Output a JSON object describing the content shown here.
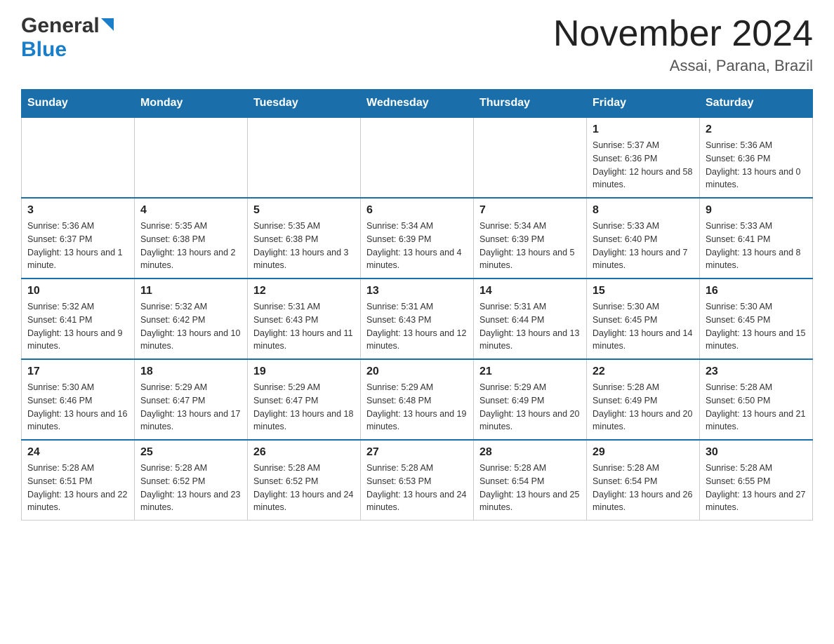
{
  "logo": {
    "general": "General",
    "blue": "Blue"
  },
  "header": {
    "title": "November 2024",
    "location": "Assai, Parana, Brazil"
  },
  "weekdays": [
    "Sunday",
    "Monday",
    "Tuesday",
    "Wednesday",
    "Thursday",
    "Friday",
    "Saturday"
  ],
  "weeks": [
    [
      {
        "day": "",
        "info": ""
      },
      {
        "day": "",
        "info": ""
      },
      {
        "day": "",
        "info": ""
      },
      {
        "day": "",
        "info": ""
      },
      {
        "day": "",
        "info": ""
      },
      {
        "day": "1",
        "info": "Sunrise: 5:37 AM\nSunset: 6:36 PM\nDaylight: 12 hours and 58 minutes."
      },
      {
        "day": "2",
        "info": "Sunrise: 5:36 AM\nSunset: 6:36 PM\nDaylight: 13 hours and 0 minutes."
      }
    ],
    [
      {
        "day": "3",
        "info": "Sunrise: 5:36 AM\nSunset: 6:37 PM\nDaylight: 13 hours and 1 minute."
      },
      {
        "day": "4",
        "info": "Sunrise: 5:35 AM\nSunset: 6:38 PM\nDaylight: 13 hours and 2 minutes."
      },
      {
        "day": "5",
        "info": "Sunrise: 5:35 AM\nSunset: 6:38 PM\nDaylight: 13 hours and 3 minutes."
      },
      {
        "day": "6",
        "info": "Sunrise: 5:34 AM\nSunset: 6:39 PM\nDaylight: 13 hours and 4 minutes."
      },
      {
        "day": "7",
        "info": "Sunrise: 5:34 AM\nSunset: 6:39 PM\nDaylight: 13 hours and 5 minutes."
      },
      {
        "day": "8",
        "info": "Sunrise: 5:33 AM\nSunset: 6:40 PM\nDaylight: 13 hours and 7 minutes."
      },
      {
        "day": "9",
        "info": "Sunrise: 5:33 AM\nSunset: 6:41 PM\nDaylight: 13 hours and 8 minutes."
      }
    ],
    [
      {
        "day": "10",
        "info": "Sunrise: 5:32 AM\nSunset: 6:41 PM\nDaylight: 13 hours and 9 minutes."
      },
      {
        "day": "11",
        "info": "Sunrise: 5:32 AM\nSunset: 6:42 PM\nDaylight: 13 hours and 10 minutes."
      },
      {
        "day": "12",
        "info": "Sunrise: 5:31 AM\nSunset: 6:43 PM\nDaylight: 13 hours and 11 minutes."
      },
      {
        "day": "13",
        "info": "Sunrise: 5:31 AM\nSunset: 6:43 PM\nDaylight: 13 hours and 12 minutes."
      },
      {
        "day": "14",
        "info": "Sunrise: 5:31 AM\nSunset: 6:44 PM\nDaylight: 13 hours and 13 minutes."
      },
      {
        "day": "15",
        "info": "Sunrise: 5:30 AM\nSunset: 6:45 PM\nDaylight: 13 hours and 14 minutes."
      },
      {
        "day": "16",
        "info": "Sunrise: 5:30 AM\nSunset: 6:45 PM\nDaylight: 13 hours and 15 minutes."
      }
    ],
    [
      {
        "day": "17",
        "info": "Sunrise: 5:30 AM\nSunset: 6:46 PM\nDaylight: 13 hours and 16 minutes."
      },
      {
        "day": "18",
        "info": "Sunrise: 5:29 AM\nSunset: 6:47 PM\nDaylight: 13 hours and 17 minutes."
      },
      {
        "day": "19",
        "info": "Sunrise: 5:29 AM\nSunset: 6:47 PM\nDaylight: 13 hours and 18 minutes."
      },
      {
        "day": "20",
        "info": "Sunrise: 5:29 AM\nSunset: 6:48 PM\nDaylight: 13 hours and 19 minutes."
      },
      {
        "day": "21",
        "info": "Sunrise: 5:29 AM\nSunset: 6:49 PM\nDaylight: 13 hours and 20 minutes."
      },
      {
        "day": "22",
        "info": "Sunrise: 5:28 AM\nSunset: 6:49 PM\nDaylight: 13 hours and 20 minutes."
      },
      {
        "day": "23",
        "info": "Sunrise: 5:28 AM\nSunset: 6:50 PM\nDaylight: 13 hours and 21 minutes."
      }
    ],
    [
      {
        "day": "24",
        "info": "Sunrise: 5:28 AM\nSunset: 6:51 PM\nDaylight: 13 hours and 22 minutes."
      },
      {
        "day": "25",
        "info": "Sunrise: 5:28 AM\nSunset: 6:52 PM\nDaylight: 13 hours and 23 minutes."
      },
      {
        "day": "26",
        "info": "Sunrise: 5:28 AM\nSunset: 6:52 PM\nDaylight: 13 hours and 24 minutes."
      },
      {
        "day": "27",
        "info": "Sunrise: 5:28 AM\nSunset: 6:53 PM\nDaylight: 13 hours and 24 minutes."
      },
      {
        "day": "28",
        "info": "Sunrise: 5:28 AM\nSunset: 6:54 PM\nDaylight: 13 hours and 25 minutes."
      },
      {
        "day": "29",
        "info": "Sunrise: 5:28 AM\nSunset: 6:54 PM\nDaylight: 13 hours and 26 minutes."
      },
      {
        "day": "30",
        "info": "Sunrise: 5:28 AM\nSunset: 6:55 PM\nDaylight: 13 hours and 27 minutes."
      }
    ]
  ]
}
